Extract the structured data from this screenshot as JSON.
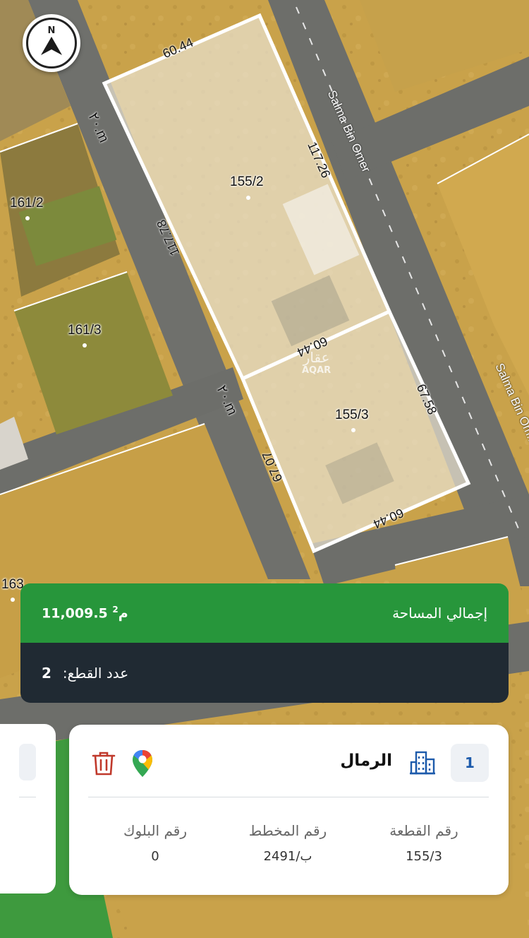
{
  "map": {
    "compass_letter": "N",
    "parcel_labels": {
      "p155_2": "155/2",
      "p155_3": "155/3",
      "p161_2": "161/2",
      "p161_3": "161/3",
      "p163": "163"
    },
    "dimensions": {
      "top": "60.44",
      "right_upper": "117.26",
      "left_upper": "117.78",
      "middle": "60.44",
      "right_lower": "67.58",
      "left_lower": "67.07",
      "bottom": "60.44"
    },
    "road_labels": {
      "upper": "٢٠.m",
      "lower": "٢٠.m"
    },
    "street_names": {
      "upper": "Salma Bin Omer",
      "lower": "Salma Bin Om..."
    },
    "watermark": {
      "arabic": "عقار",
      "latin": "AQAR"
    }
  },
  "summary": {
    "total_area_label": "إجمالي المساحة",
    "total_area_value": "11,009.5 م",
    "total_area_unit_sup": "2",
    "plot_count_label": "عدد القطع:",
    "plot_count_value": "2"
  },
  "card": {
    "index": "1",
    "district": "الرمال",
    "fields": {
      "plot_number_label": "رقم القطعة",
      "plot_number_value": "155/3",
      "plan_number_label": "رقم المخطط",
      "plan_number_value": "2491/ب",
      "block_number_label": "رقم البلوك",
      "block_number_value": "0"
    },
    "icons": [
      "building-icon",
      "google-maps-pin-icon",
      "trash-icon"
    ]
  },
  "colors": {
    "summary_green": "#27963b",
    "summary_dark": "#202a33",
    "accent_blue": "#1d5bab",
    "trash_red": "#c0392b",
    "parcel_outline": "#ffffff"
  }
}
